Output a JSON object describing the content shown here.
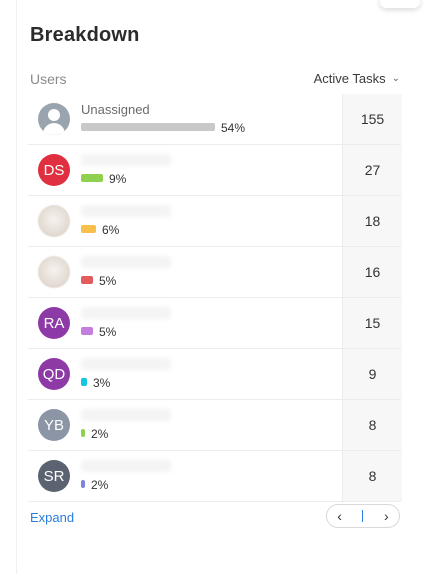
{
  "header": {
    "title": "Breakdown"
  },
  "columns": {
    "users_label": "Users",
    "sort_label": "Active Tasks"
  },
  "rows": [
    {
      "name": "Unassigned",
      "pct": "54%",
      "count": "155",
      "bar_color": "#c8c8c8",
      "bar_fraction": 0.54,
      "avatar": "person-icon"
    },
    {
      "initials": "DS",
      "avatar_color": "#e02f3f",
      "pct": "9%",
      "count": "27",
      "bar_color": "#8fd14f",
      "bar_fraction": 0.09
    },
    {
      "avatar": "photo",
      "pct": "6%",
      "count": "18",
      "bar_color": "#f7c04a",
      "bar_fraction": 0.06
    },
    {
      "avatar": "photo",
      "pct": "5%",
      "count": "16",
      "bar_color": "#e35b5b",
      "bar_fraction": 0.05
    },
    {
      "initials": "RA",
      "avatar_color": "#8e3aa6",
      "pct": "5%",
      "count": "15",
      "bar_color": "#c57de0",
      "bar_fraction": 0.05
    },
    {
      "initials": "QD",
      "avatar_color": "#8e3aa6",
      "pct": "3%",
      "count": "9",
      "bar_color": "#12c5e0",
      "bar_fraction": 0.03
    },
    {
      "initials": "YB",
      "avatar_color": "#8b95a5",
      "pct": "2%",
      "count": "8",
      "bar_color": "#8fd14f",
      "bar_fraction": 0.02
    },
    {
      "initials": "SR",
      "avatar_color": "#5b6270",
      "pct": "2%",
      "count": "8",
      "bar_color": "#7b86d9",
      "bar_fraction": 0.02
    }
  ],
  "footer": {
    "expand_label": "Expand",
    "prev_icon": "‹",
    "next_icon": "›"
  }
}
